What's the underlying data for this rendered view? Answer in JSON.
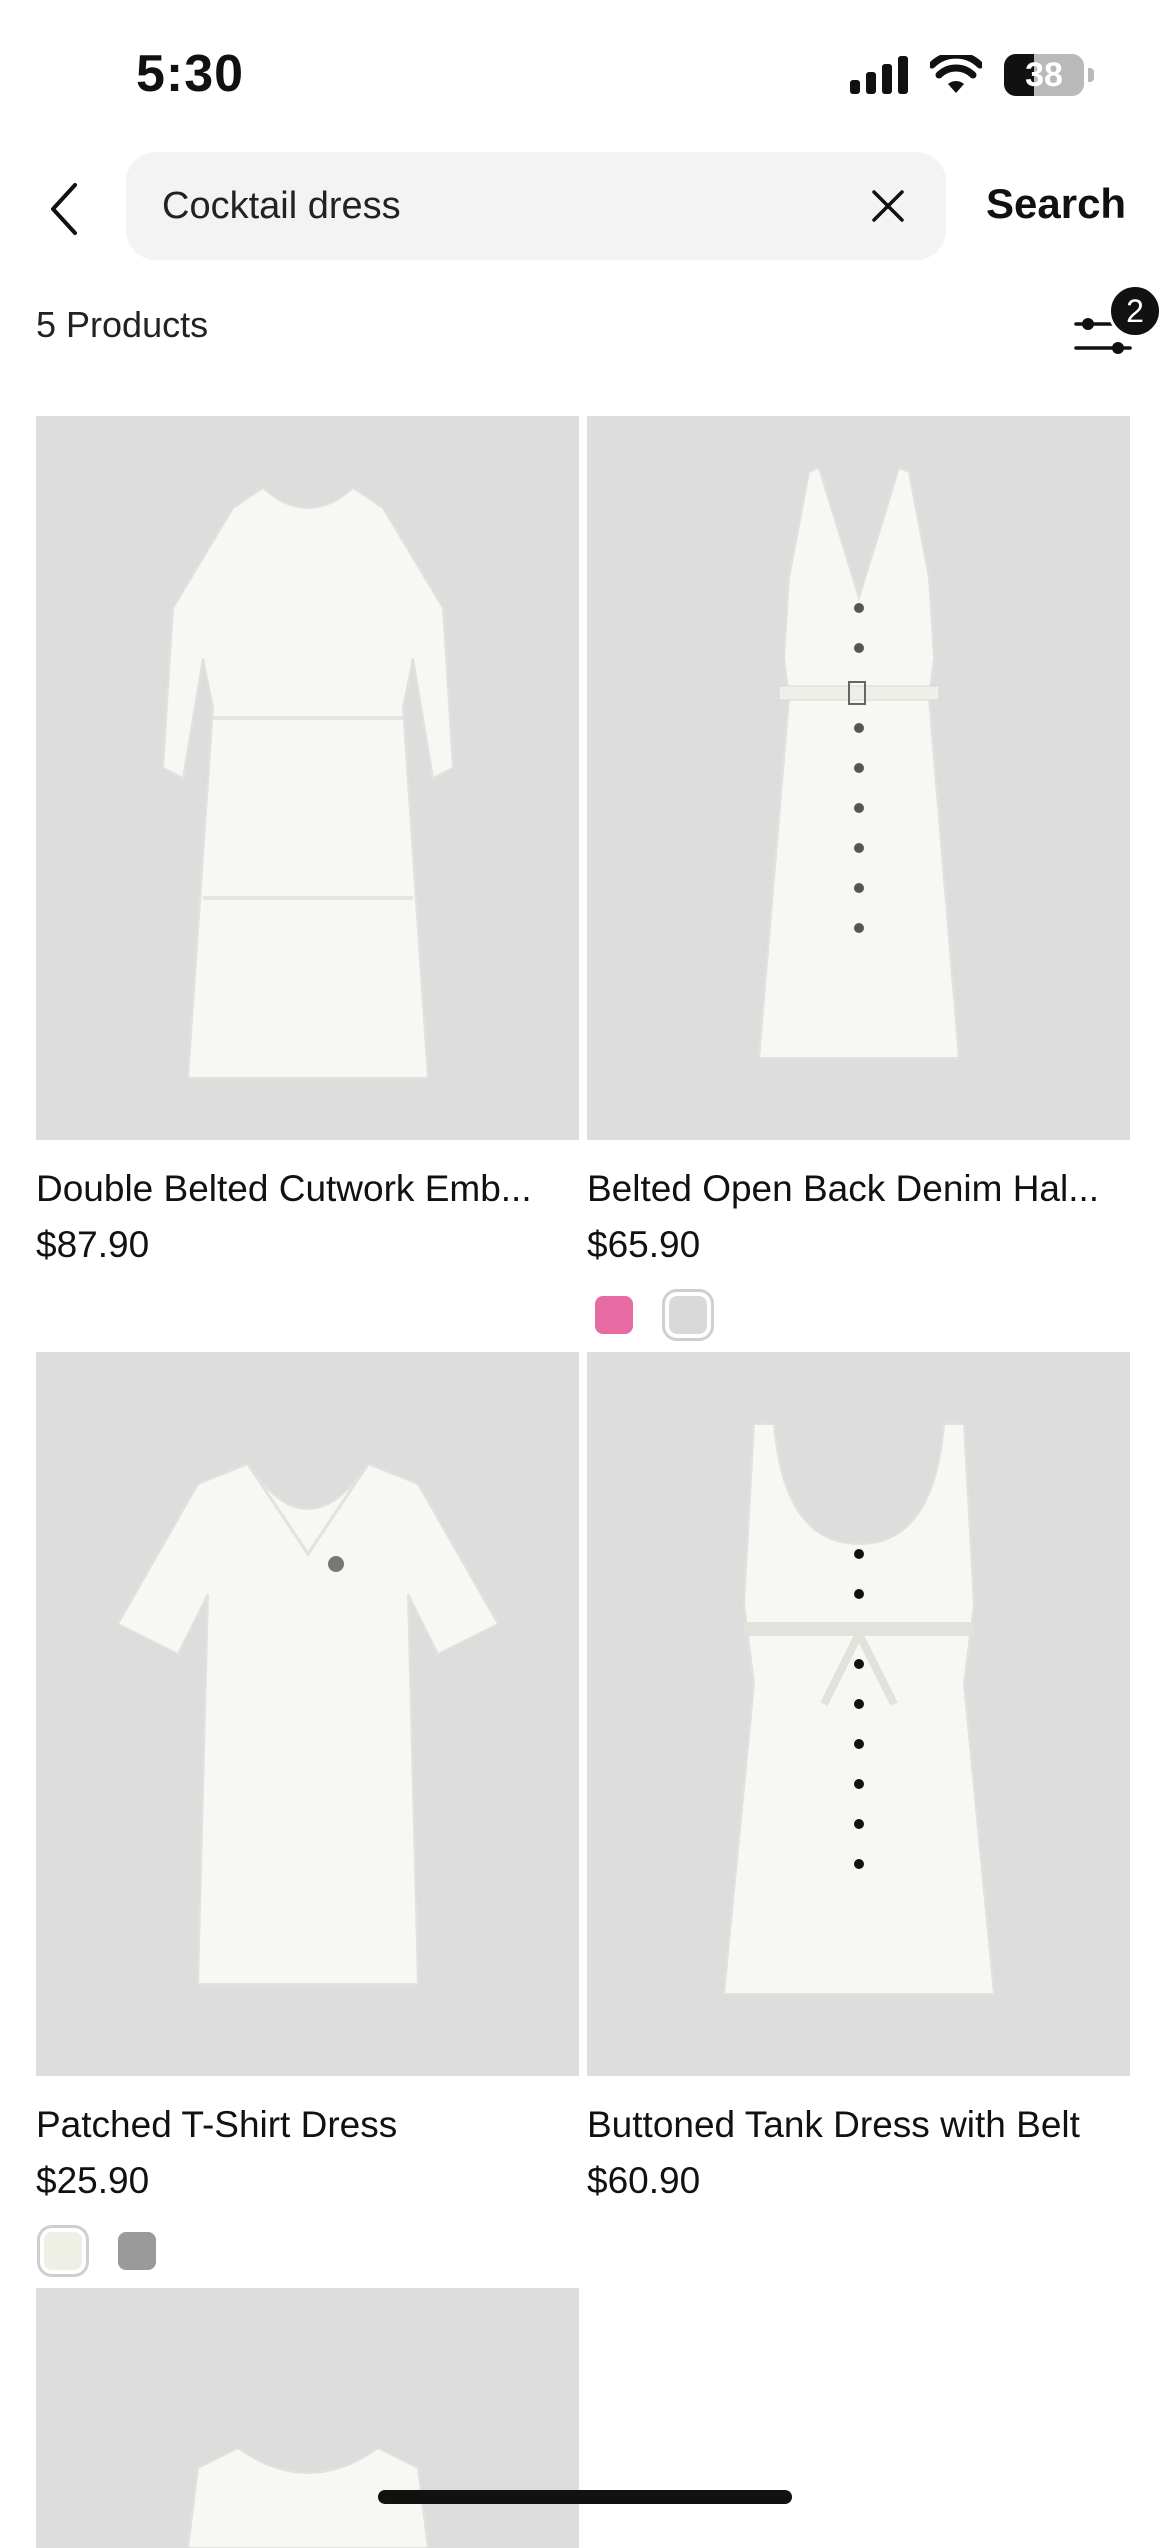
{
  "status_bar": {
    "time": "5:30",
    "battery": "38"
  },
  "search": {
    "value": "Cocktail dress",
    "placeholder": "",
    "search_label": "Search"
  },
  "results": {
    "count_label": "5 Products",
    "filter_badge": "2"
  },
  "products": [
    {
      "title": "Double Belted Cutwork Emb...",
      "price": "$87.90",
      "swatches": []
    },
    {
      "title": "Belted Open Back Denim Hal...",
      "price": "$65.90",
      "swatches": [
        "#e86aa2",
        "#d9d9d9"
      ]
    },
    {
      "title": "Patched T-Shirt Dress",
      "price": "$25.90",
      "swatches": [
        "#eef0e6",
        "#9a9a9a"
      ]
    },
    {
      "title": "Buttoned Tank Dress with Belt",
      "price": "$60.90",
      "swatches": []
    },
    {
      "title": "",
      "price": "",
      "swatches": []
    }
  ],
  "colors": {
    "accent": "#111111",
    "image_bg": "#dddddd",
    "search_bg": "#f3f3f3"
  }
}
